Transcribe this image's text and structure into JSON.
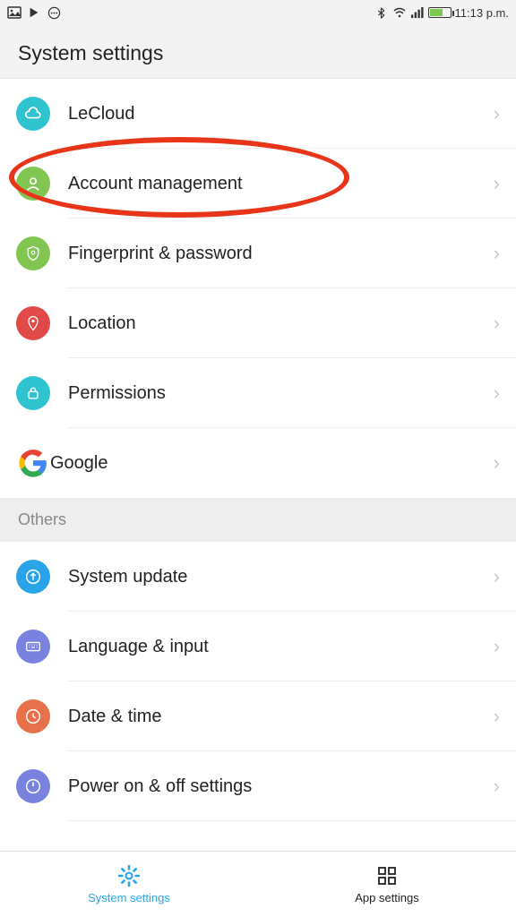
{
  "status": {
    "time": "11:13 p.m."
  },
  "header": {
    "title": "System settings"
  },
  "items": [
    {
      "label": "LeCloud"
    },
    {
      "label": "Account management"
    },
    {
      "label": "Fingerprint & password"
    },
    {
      "label": "Location"
    },
    {
      "label": "Permissions"
    },
    {
      "label": "Google"
    }
  ],
  "section": {
    "others_label": "Others"
  },
  "others": [
    {
      "label": "System update"
    },
    {
      "label": "Language & input"
    },
    {
      "label": "Date & time"
    },
    {
      "label": "Power on & off settings"
    }
  ],
  "tabs": {
    "system": "System settings",
    "app": "App settings"
  },
  "colors": {
    "teal": "#2fc3d0",
    "green": "#81c553",
    "red": "#e24a4a",
    "blue": "#2aa4e8",
    "violet": "#7a82e0",
    "orange": "#e8704a"
  }
}
